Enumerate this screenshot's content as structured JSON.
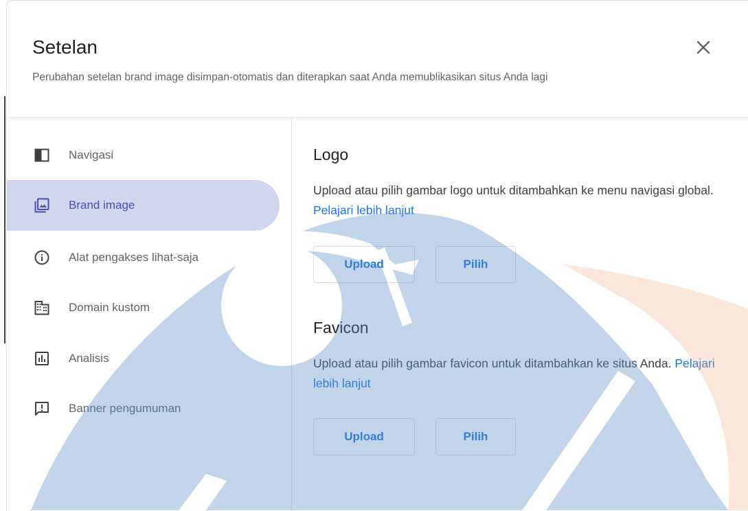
{
  "dialog": {
    "title": "Setelan",
    "subtitle": "Perubahan setelan brand image disimpan-otomatis dan diterapkan saat Anda memublikasikan situs Anda lagi"
  },
  "sidebar": {
    "items": [
      {
        "label": "Navigasi",
        "icon": "sidebar-panel-icon"
      },
      {
        "label": "Brand image",
        "icon": "image-gallery-icon",
        "active": true
      },
      {
        "label": "Alat pengakses lihat-saja",
        "icon": "info-icon"
      },
      {
        "label": "Domain kustom",
        "icon": "building-icon"
      },
      {
        "label": "Analisis",
        "icon": "bar-chart-icon"
      },
      {
        "label": "Banner pengumuman",
        "icon": "announcement-icon"
      }
    ]
  },
  "content": {
    "logo": {
      "title": "Logo",
      "description": "Upload atau pilih gambar logo untuk ditambahkan ke menu navigasi global.",
      "link": "Pelajari lebih lanjut",
      "upload_label": "Upload",
      "choose_label": "Pilih"
    },
    "favicon": {
      "title": "Favicon",
      "description": "Upload atau pilih gambar favicon untuk ditambahkan ke situs Anda.",
      "link": "Pelajari lebih lanjut",
      "upload_label": "Upload",
      "choose_label": "Pilih"
    }
  },
  "colors": {
    "accent": "#1a73e8",
    "active_nav_bg": "#d2d5ee",
    "active_nav_text": "#3f51b5",
    "watermark_blue": "#5b8ec9",
    "watermark_orange": "#f2a77a"
  }
}
